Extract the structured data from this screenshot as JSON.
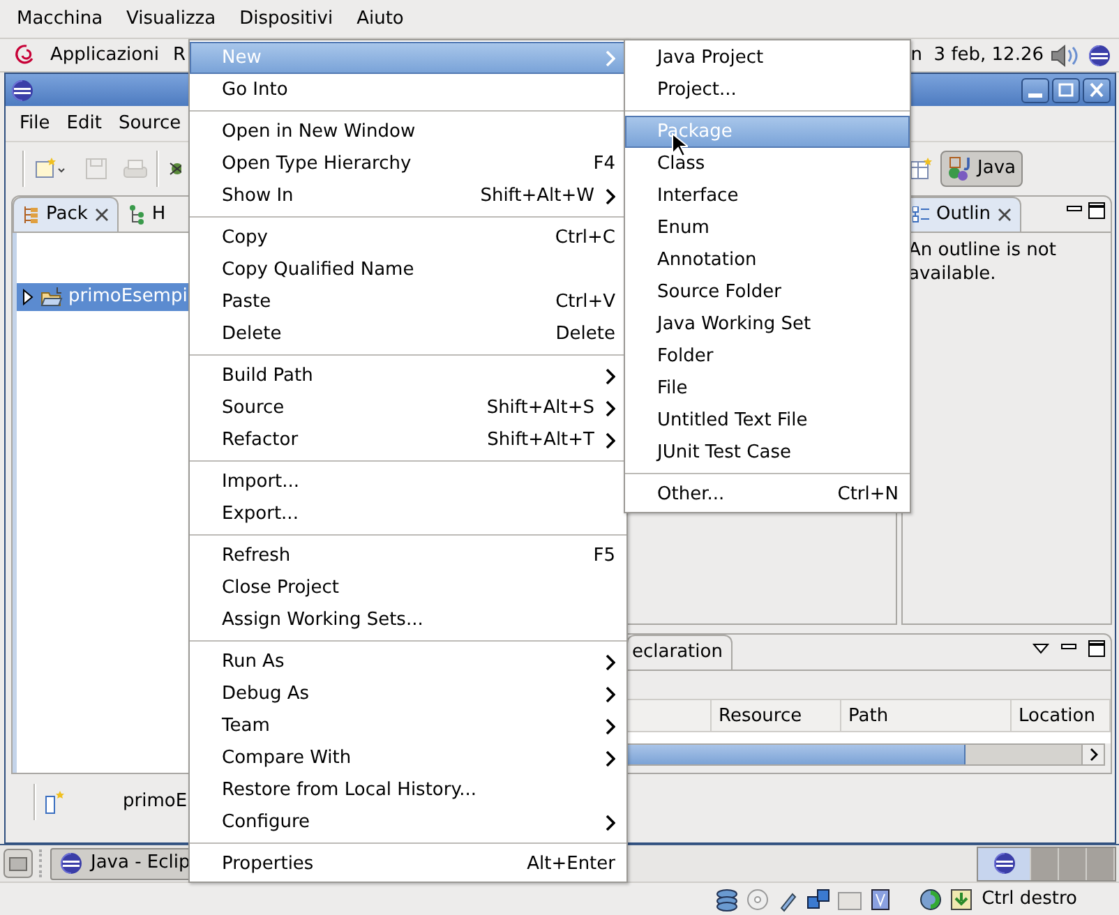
{
  "vm_menubar": {
    "items": [
      "Macchina",
      "Visualizza",
      "Dispositivi",
      "Aiuto"
    ]
  },
  "desktop_panel": {
    "items": [
      "Applicazioni",
      "R"
    ],
    "clock": "n  3 feb, 12.26"
  },
  "eclipse": {
    "menubar": [
      "File",
      "Edit",
      "Source"
    ],
    "perspective_button": {
      "label": "Java",
      "selected": true
    },
    "package_explorer": {
      "tabs": [
        {
          "label": "Pack",
          "selected": true
        },
        {
          "label": "H",
          "selected": false
        }
      ],
      "tree": [
        {
          "label": "primoEsempi",
          "selected": true,
          "expanded": false
        }
      ]
    },
    "outline": {
      "tab": "Outlin",
      "message": "An outline is not available."
    },
    "bottom_panel": {
      "tab": "eclaration",
      "columns": [
        "Resource",
        "Path",
        "Location"
      ],
      "scroll": {
        "level": 0.82
      }
    },
    "status_bar": {
      "text": "primoE"
    }
  },
  "context_menu": {
    "groups": [
      [
        {
          "label": "New",
          "submenu": true,
          "selected": true
        },
        {
          "label": "Go Into",
          "submenu": false,
          "selected": false
        }
      ],
      [
        {
          "label": "Open in New Window",
          "submenu": false,
          "selected": false
        },
        {
          "label": "Open Type Hierarchy",
          "shortcut": "F4",
          "submenu": false,
          "selected": false
        },
        {
          "label": "Show In",
          "shortcut": "Shift+Alt+W",
          "submenu": true,
          "selected": false
        }
      ],
      [
        {
          "label": "Copy",
          "shortcut": "Ctrl+C",
          "submenu": false,
          "selected": false
        },
        {
          "label": "Copy Qualified Name",
          "submenu": false,
          "selected": false
        },
        {
          "label": "Paste",
          "shortcut": "Ctrl+V",
          "submenu": false,
          "selected": false
        },
        {
          "label": "Delete",
          "shortcut": "Delete",
          "submenu": false,
          "selected": false
        }
      ],
      [
        {
          "label": "Build Path",
          "submenu": true,
          "selected": false
        },
        {
          "label": "Source",
          "shortcut": "Shift+Alt+S",
          "submenu": true,
          "selected": false
        },
        {
          "label": "Refactor",
          "shortcut": "Shift+Alt+T",
          "submenu": true,
          "selected": false
        }
      ],
      [
        {
          "label": "Import...",
          "submenu": false,
          "selected": false
        },
        {
          "label": "Export...",
          "submenu": false,
          "selected": false
        }
      ],
      [
        {
          "label": "Refresh",
          "shortcut": "F5",
          "submenu": false,
          "selected": false
        },
        {
          "label": "Close Project",
          "submenu": false,
          "selected": false
        },
        {
          "label": "Assign Working Sets...",
          "submenu": false,
          "selected": false
        }
      ],
      [
        {
          "label": "Run As",
          "submenu": true,
          "selected": false
        },
        {
          "label": "Debug As",
          "submenu": true,
          "selected": false
        },
        {
          "label": "Team",
          "submenu": true,
          "selected": false
        },
        {
          "label": "Compare With",
          "submenu": true,
          "selected": false
        },
        {
          "label": "Restore from Local History...",
          "submenu": false,
          "selected": false
        },
        {
          "label": "Configure",
          "submenu": true,
          "selected": false
        }
      ],
      [
        {
          "label": "Properties",
          "shortcut": "Alt+Enter",
          "submenu": false,
          "selected": false
        }
      ]
    ]
  },
  "submenu": {
    "groups": [
      [
        {
          "label": "Java Project",
          "submenu": false,
          "selected": false
        },
        {
          "label": "Project...",
          "submenu": false,
          "selected": false
        }
      ],
      [
        {
          "label": "Package",
          "submenu": false,
          "selected": true
        },
        {
          "label": "Class",
          "submenu": false,
          "selected": false
        },
        {
          "label": "Interface",
          "submenu": false,
          "selected": false
        },
        {
          "label": "Enum",
          "submenu": false,
          "selected": false
        },
        {
          "label": "Annotation",
          "submenu": false,
          "selected": false
        },
        {
          "label": "Source Folder",
          "submenu": false,
          "selected": false
        },
        {
          "label": "Java Working Set",
          "submenu": false,
          "selected": false
        },
        {
          "label": "Folder",
          "submenu": false,
          "selected": false
        },
        {
          "label": "File",
          "submenu": false,
          "selected": false
        },
        {
          "label": "Untitled Text File",
          "submenu": false,
          "selected": false
        },
        {
          "label": "JUnit Test Case",
          "submenu": false,
          "selected": false
        }
      ],
      [
        {
          "label": "Other...",
          "shortcut": "Ctrl+N",
          "submenu": false,
          "selected": false
        }
      ]
    ]
  },
  "taskbar": {
    "buttons": [
      {
        "label": "Java - Eclip",
        "selected": true
      }
    ],
    "workspaces": [
      {
        "selected": true
      },
      {
        "selected": false
      },
      {
        "selected": false
      },
      {
        "selected": false
      }
    ]
  },
  "vm_statusbar": {
    "host_key": "Ctrl destro"
  }
}
